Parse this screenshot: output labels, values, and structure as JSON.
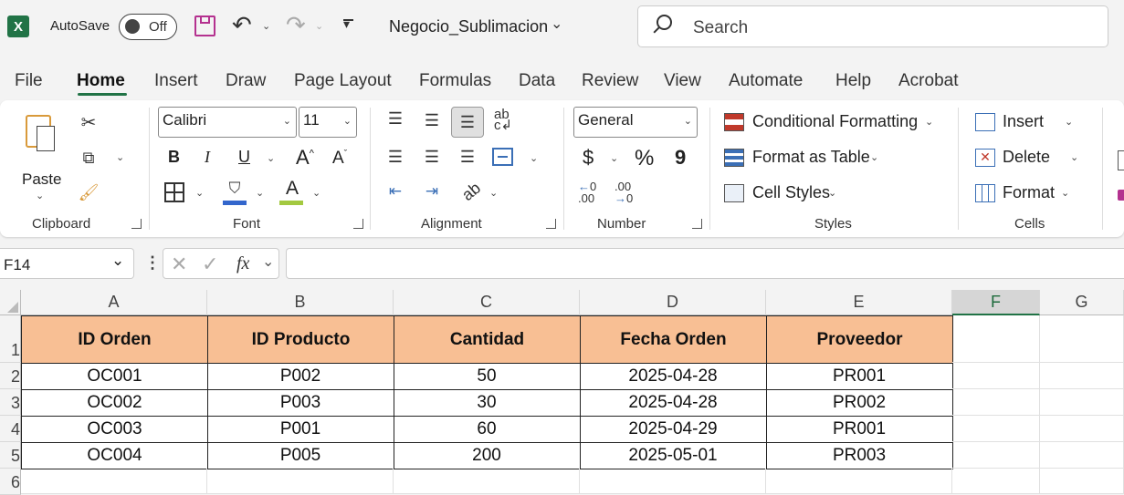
{
  "titlebar": {
    "autosave_label": "AutoSave",
    "autosave_state": "Off",
    "filename": "Negocio_Sublimacion",
    "search_placeholder": "Search"
  },
  "tabs": [
    "File",
    "Home",
    "Insert",
    "Draw",
    "Page Layout",
    "Formulas",
    "Data",
    "Review",
    "View",
    "Automate",
    "Help",
    "Acrobat"
  ],
  "active_tab": "Home",
  "ribbon": {
    "clipboard": {
      "paste_label": "Paste",
      "group_label": "Clipboard"
    },
    "font": {
      "font_name": "Calibri",
      "font_size": "11",
      "group_label": "Font",
      "bold": "B",
      "italic": "I",
      "underline": "U"
    },
    "alignment": {
      "group_label": "Alignment"
    },
    "number": {
      "format": "General",
      "currency": "$",
      "percent": "%",
      "comma": "9",
      "group_label": "Number"
    },
    "styles": {
      "conditional_formatting": "Conditional Formatting",
      "format_as_table": "Format as Table",
      "cell_styles": "Cell Styles",
      "group_label": "Styles"
    },
    "cells": {
      "insert": "Insert",
      "delete": "Delete",
      "format": "Format",
      "group_label": "Cells"
    }
  },
  "formula_bar": {
    "name_box": "F14",
    "fx": "fx",
    "formula": ""
  },
  "colors": {
    "header_fill": "#f8bf94",
    "excel_green": "#217346",
    "accent_purple": "#b4318f"
  },
  "sheet": {
    "columns": [
      "A",
      "B",
      "C",
      "D",
      "E",
      "F",
      "G"
    ],
    "rows": [
      "1",
      "2",
      "3",
      "4",
      "5",
      "6"
    ],
    "header": [
      "ID Orden",
      "ID Producto",
      "Cantidad",
      "Fecha Orden",
      "Proveedor"
    ],
    "data": [
      [
        "OC001",
        "P002",
        "50",
        "2025-04-28",
        "PR001"
      ],
      [
        "OC002",
        "P003",
        "30",
        "2025-04-28",
        "PR002"
      ],
      [
        "OC003",
        "P001",
        "60",
        "2025-04-29",
        "PR001"
      ],
      [
        "OC004",
        "P005",
        "200",
        "2025-05-01",
        "PR003"
      ]
    ]
  }
}
